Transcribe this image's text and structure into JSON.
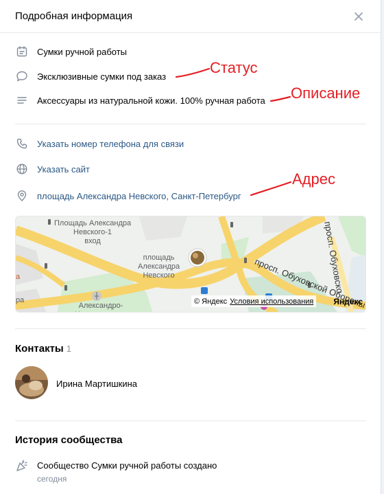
{
  "header": {
    "title": "Подробная информация"
  },
  "info": {
    "name": "Сумки ручной работы",
    "status": "Эксклюзивные сумки под заказ",
    "description": "Аксессуары из натуральной кожи. 100% ручная работа"
  },
  "annotations": {
    "status": "Статус",
    "description": "Описание",
    "address": "Адрес"
  },
  "contacts_links": {
    "phone": "Указать номер телефона для связи",
    "site": "Указать сайт",
    "address": "площадь Александра Невского, Санкт-Петербург"
  },
  "map": {
    "labels": {
      "entrance": "Площадь Александра\nНевского-1\nвход",
      "square": "площадь\nАлександра\nНевского",
      "lavra": "Александро-\nНевская лавра",
      "obukhov": "просп. Обуховской Обороны",
      "obukhov2": "просп. Обуховско",
      "left_a": "а",
      "left_ra": "ра"
    },
    "copyright": "© Яндекс",
    "terms": "Условия использования",
    "logo": "Яндекс"
  },
  "contacts": {
    "title": "Контакты",
    "count": "1",
    "person": "Ирина Мартишкина"
  },
  "history": {
    "title": "История сообщества",
    "event": "Сообщество Сумки ручной работы создано",
    "date": "сегодня"
  },
  "colors": {
    "link": "#2a5885",
    "annotation": "#e31e24",
    "icon": "#818c99"
  }
}
